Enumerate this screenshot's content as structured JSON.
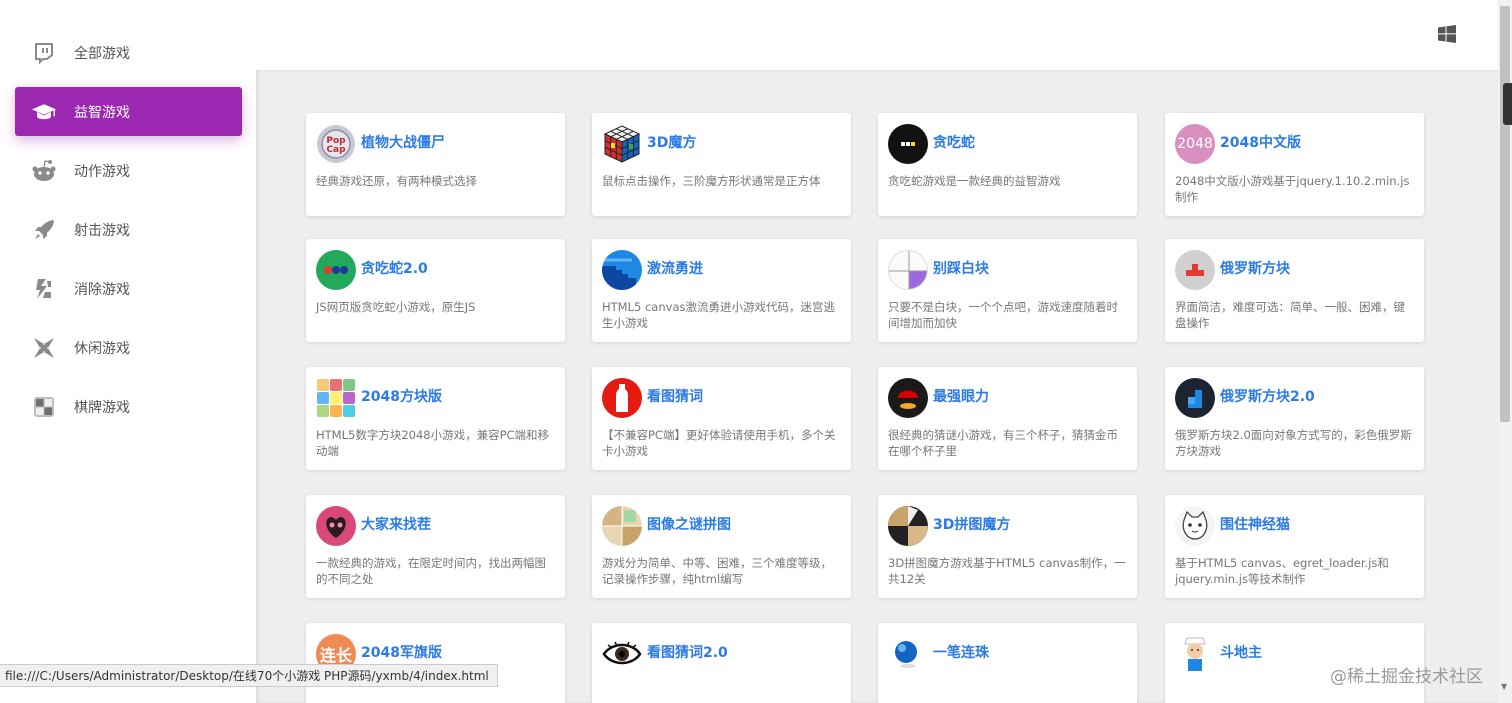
{
  "sidebar": {
    "items": [
      {
        "label": "全部游戏",
        "icon": "twitch-icon",
        "active": false
      },
      {
        "label": "益智游戏",
        "icon": "graduation-cap-icon",
        "active": true
      },
      {
        "label": "动作游戏",
        "icon": "reddit-icon",
        "active": false
      },
      {
        "label": "射击游戏",
        "icon": "rocket-icon",
        "active": false
      },
      {
        "label": "消除游戏",
        "icon": "layers-icon",
        "active": false
      },
      {
        "label": "休闲游戏",
        "icon": "pinwheel-icon",
        "active": false
      },
      {
        "label": "棋牌游戏",
        "icon": "board-icon",
        "active": false
      }
    ],
    "accent_color": "#9c27b0"
  },
  "topbar": {
    "icon": "windows-icon"
  },
  "games": [
    {
      "title": "植物大战僵尸",
      "desc": "经典游戏还原，有两种模式选择"
    },
    {
      "title": "3D魔方",
      "desc": "鼠标点击操作，三阶魔方形状通常是正方体"
    },
    {
      "title": "贪吃蛇",
      "desc": "贪吃蛇游戏是一款经典的益智游戏"
    },
    {
      "title": "2048中文版",
      "desc": "2048中文版小游戏基于jquery.1.10.2.min.js制作",
      "thumb_text": "2048"
    },
    {
      "title": "贪吃蛇2.0",
      "desc": "JS网页版贪吃蛇小游戏，原生JS"
    },
    {
      "title": "激流勇进",
      "desc": "HTML5 canvas激流勇进小游戏代码，迷宫逃生小游戏"
    },
    {
      "title": "别踩白块",
      "desc": "只要不是白块，一个个点吧，游戏速度随着时间增加而加快"
    },
    {
      "title": "俄罗斯方块",
      "desc": "界面简洁，难度可选：简单、一般、困难，键盘操作"
    },
    {
      "title": "2048方块版",
      "desc": "HTML5数字方块2048小游戏，兼容PC端和移动端"
    },
    {
      "title": "看图猜词",
      "desc": "【不兼容PC端】更好体验请使用手机，多个关卡小游戏"
    },
    {
      "title": "最强眼力",
      "desc": "很经典的猜谜小游戏，有三个杯子，猜猜金币在哪个杯子里"
    },
    {
      "title": "俄罗斯方块2.0",
      "desc": "俄罗斯方块2.0面向对象方式写的，彩色俄罗斯方块游戏"
    },
    {
      "title": "大家来找茬",
      "desc": "一款经典的游戏，在限定时间内，找出两幅图的不同之处"
    },
    {
      "title": "图像之谜拼图",
      "desc": "游戏分为简单、中等、困难，三个难度等级，记录操作步骤，纯html编写"
    },
    {
      "title": "3D拼图魔方",
      "desc": "3D拼图魔方游戏基于HTML5 canvas制作，一共12关"
    },
    {
      "title": "围住神经猫",
      "desc": "基于HTML5 canvas、egret_loader.js和jquery.min.js等技术制作"
    },
    {
      "title": "2048军旗版",
      "desc": "",
      "thumb_text": "连长"
    },
    {
      "title": "看图猜词2.0",
      "desc": ""
    },
    {
      "title": "一笔连珠",
      "desc": ""
    },
    {
      "title": "斗地主",
      "desc": ""
    }
  ],
  "status_bar": {
    "url": "file:///C:/Users/Administrator/Desktop/在线70个小游戏 PHP源码/yxmb/4/index.html"
  },
  "watermark": "@稀土掘金技术社区"
}
